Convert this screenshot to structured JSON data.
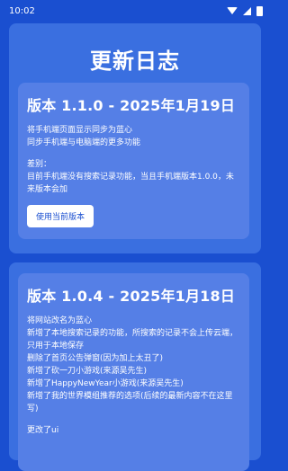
{
  "status_bar": {
    "time": "10:02"
  },
  "page": {
    "title": "更新日志"
  },
  "entries": [
    {
      "title": "版本 1.1.0 - 2025年1月19日",
      "lines": [
        "将手机端页面显示同步为蓝心",
        "同步手机端与电脑端的更多功能"
      ],
      "diff_label": "差别：",
      "diff_text": "目前手机端没有搜索记录功能，当且手机端版本1.0.0，未来版本会加",
      "button": "使用当前版本"
    },
    {
      "title": "版本 1.0.4 - 2025年1月18日",
      "lines": [
        "将网站改名为蓝心",
        "新增了本地搜索记录的功能，所搜索的记录不会上传云端，只用于本地保存",
        "删除了首页公告弹窗(因为加上太丑了)",
        "新增了砍一刀小游戏(来源吴先生)",
        "新增了HappyNewYear小游戏(来源吴先生)",
        "新增了我的世界模组推荐的选项(后续的最新内容不在这里写)",
        "更改了ui"
      ]
    }
  ]
}
